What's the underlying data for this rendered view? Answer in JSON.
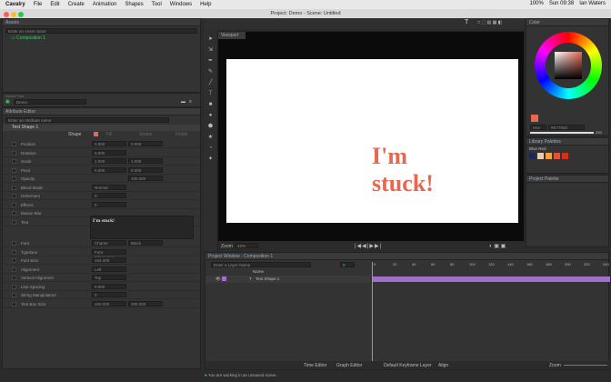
{
  "menubar": {
    "app": "Cavalry",
    "items": [
      "File",
      "Edit",
      "Create",
      "Animation",
      "Shapes",
      "Tool",
      "Windows",
      "Help"
    ],
    "battery": "100%",
    "clock": "Sun 09:38",
    "user": "Ian Waters"
  },
  "window": {
    "title": "Project: Demo - Scene: Untitled"
  },
  "assets": {
    "title": "Assets",
    "search_placeholder": "Enter an Asset name",
    "item": "Composition 1"
  },
  "scene_tree": {
    "label": "Scene Tree",
    "combo": "Demo"
  },
  "attribute_editor": {
    "title": "Attribute Editor",
    "search_placeholder": "Enter an Attribute name",
    "layer": "Text Shape 1",
    "tabs": [
      "Shape",
      "Fill",
      "Stroke",
      "Fields"
    ],
    "rows": [
      {
        "label": "Position",
        "a": "0.000",
        "b": "0.000"
      },
      {
        "label": "Rotation",
        "a": "0.000",
        "b": ""
      },
      {
        "label": "Scale",
        "a": "1.000",
        "b": "1.000"
      },
      {
        "label": "Pivot",
        "a": "0.000",
        "b": "0.000"
      },
      {
        "label": "Opacity",
        "a": "",
        "b": "100.000"
      },
      {
        "label": "Blend Mode",
        "a": "Normal",
        "b": ""
      },
      {
        "label": "Deformers",
        "a": "0",
        "b": ""
      },
      {
        "label": "Effects",
        "a": "0",
        "b": ""
      },
      {
        "label": "Motion Blur",
        "a": "",
        "b": ""
      },
      {
        "label": "Text",
        "a": "",
        "b": ""
      }
    ],
    "text_value": "I'm stuck!",
    "rows2": [
      {
        "label": "Font",
        "a": "Charter",
        "b": "Black"
      },
      {
        "label": "Typeface",
        "a": "Font Information...",
        "b": ""
      },
      {
        "label": "Font Size",
        "a": "154.000",
        "b": ""
      },
      {
        "label": "Alignment",
        "a": "Left",
        "b": ""
      },
      {
        "label": "Vertical Alignment",
        "a": "Top",
        "b": ""
      },
      {
        "label": "Line Spacing",
        "a": "0.000",
        "b": ""
      },
      {
        "label": "String Manipulators",
        "a": "0",
        "b": ""
      },
      {
        "label": "Text Box Size",
        "a": "400.000",
        "b": "300.000"
      }
    ]
  },
  "viewport": {
    "title": "Viewport",
    "canvas_text": "I'm\nstuck!",
    "text_color": "#e8674e",
    "zoom_label": "Zoom",
    "zoom": "42%"
  },
  "color_panel": {
    "title": "Color",
    "mode": "Hex",
    "hex": "#E7765C",
    "alpha": "255",
    "palettes_label": "Library Palettes",
    "palette_name": "Blue Red",
    "project_palette": "Project Palette",
    "swatches": [
      "#1a2a55",
      "#f0c8b0",
      "#f4a040",
      "#e85030",
      "#d43020"
    ]
  },
  "timeline": {
    "title": "Project Window - Composition 1",
    "search_placeholder": "Enter a Layer Name",
    "name_header": "Name",
    "layer": "Text Shape 1",
    "frame": "0",
    "ticks": [
      "0",
      "20",
      "40",
      "60",
      "80",
      "100",
      "120",
      "140",
      "160",
      "180",
      "200",
      "220",
      "240"
    ],
    "tabs": [
      "Time Editor",
      "Graph Editor"
    ],
    "keyframe_layer": "Default Keyframe Layer",
    "align": "Align",
    "zoom_label": "Zoom"
  },
  "status": {
    "message": "You are working in an unsaved scene."
  }
}
